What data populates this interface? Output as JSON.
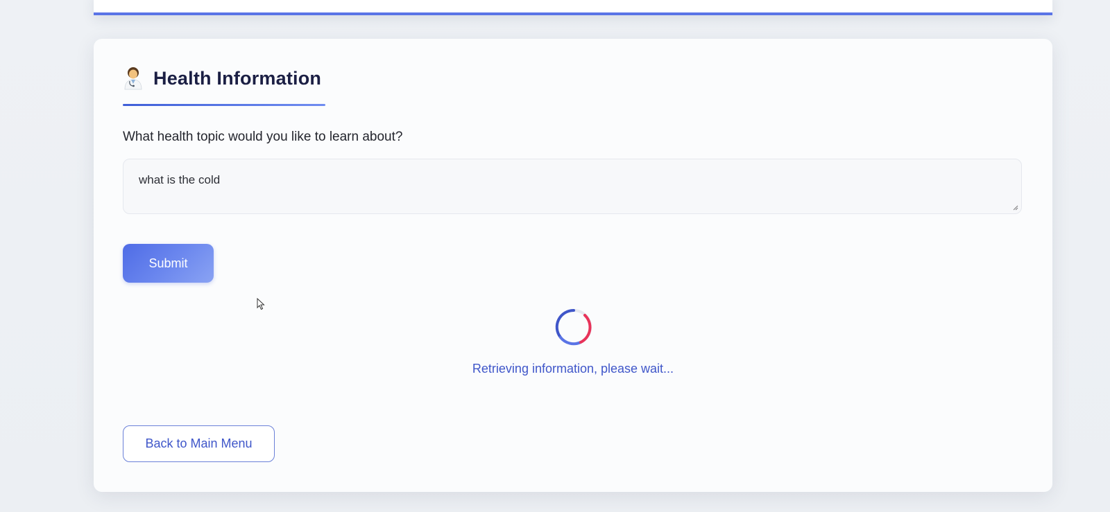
{
  "header": {
    "title": "Health Information",
    "icon": "health-worker-icon"
  },
  "form": {
    "question_label": "What health topic would you like to learn about?",
    "input_value": "what is the cold",
    "submit_label": "Submit"
  },
  "status": {
    "loading_text": "Retrieving information, please wait..."
  },
  "nav": {
    "back_label": "Back to Main Menu"
  },
  "colors": {
    "accent": "#5a74e6",
    "spinner_primary": "#3f56c9",
    "spinner_secondary": "#e8335a",
    "title": "#1b1f44"
  }
}
